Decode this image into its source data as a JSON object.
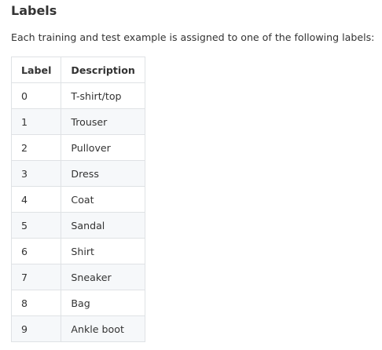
{
  "heading": "Labels",
  "intro": "Each training and test example is assigned to one of the following labels:",
  "table": {
    "headers": [
      "Label",
      "Description"
    ],
    "rows": [
      [
        "0",
        "T-shirt/top"
      ],
      [
        "1",
        "Trouser"
      ],
      [
        "2",
        "Pullover"
      ],
      [
        "3",
        "Dress"
      ],
      [
        "4",
        "Coat"
      ],
      [
        "5",
        "Sandal"
      ],
      [
        "6",
        "Shirt"
      ],
      [
        "7",
        "Sneaker"
      ],
      [
        "8",
        "Bag"
      ],
      [
        "9",
        "Ankle boot"
      ]
    ]
  }
}
